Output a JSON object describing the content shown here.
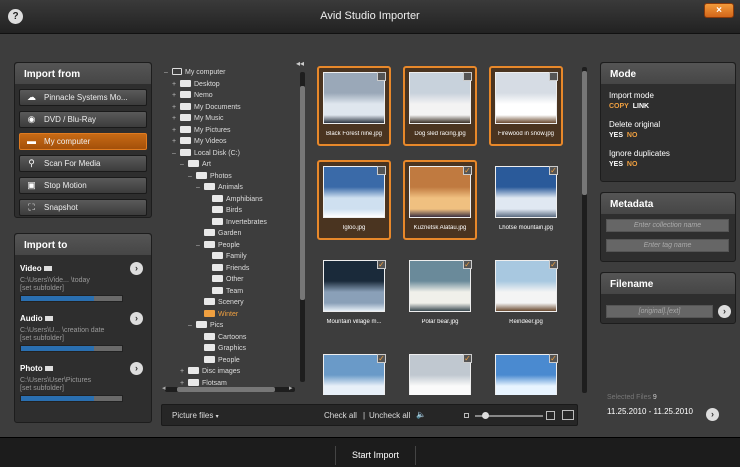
{
  "window": {
    "title": "Avid Studio Importer",
    "help": "?",
    "close": "×"
  },
  "import_from": {
    "header": "Import from",
    "sources": [
      {
        "label": "Pinnacle Systems Mo...",
        "icon": "cloud-icon"
      },
      {
        "label": "DVD / Blu-Ray",
        "icon": "disc-icon"
      },
      {
        "label": "My computer",
        "icon": "folder-icon",
        "selected": true
      },
      {
        "label": "Scan For Media",
        "icon": "magnifier-icon"
      },
      {
        "label": "Stop Motion",
        "icon": "camera-icon"
      },
      {
        "label": "Snapshot",
        "icon": "snapshot-icon"
      }
    ]
  },
  "import_to": {
    "header": "Import to",
    "items": [
      {
        "label": "Video",
        "path": "C:\\Users\\Vide... \\today",
        "subfolder": "[set subfolder]",
        "fill": 0.72
      },
      {
        "label": "Audio",
        "path": "C:\\Users\\U... \\creation date",
        "subfolder": "[set subfolder]",
        "fill": 0.72
      },
      {
        "label": "Photo",
        "path": "C:\\Users\\User\\Pictures",
        "subfolder": "[set subfolder]",
        "fill": 0.72
      }
    ]
  },
  "tree": [
    {
      "label": "My computer",
      "depth": 0,
      "toggle": "–"
    },
    {
      "label": "Desktop",
      "depth": 1,
      "toggle": "+"
    },
    {
      "label": "Nemo",
      "depth": 1,
      "toggle": "+"
    },
    {
      "label": "My Documents",
      "depth": 1,
      "toggle": "+"
    },
    {
      "label": "My Music",
      "depth": 1,
      "toggle": "+"
    },
    {
      "label": "My Pictures",
      "depth": 1,
      "toggle": "+"
    },
    {
      "label": "My Videos",
      "depth": 1,
      "toggle": "+"
    },
    {
      "label": "Local Disk (C:)",
      "depth": 1,
      "toggle": "–"
    },
    {
      "label": "Art",
      "depth": 2,
      "toggle": "–"
    },
    {
      "label": "Photos",
      "depth": 3,
      "toggle": "–"
    },
    {
      "label": "Animals",
      "depth": 4,
      "toggle": "–"
    },
    {
      "label": "Amphibians",
      "depth": 5,
      "toggle": ""
    },
    {
      "label": "Birds",
      "depth": 5,
      "toggle": ""
    },
    {
      "label": "Invertebrates",
      "depth": 5,
      "toggle": ""
    },
    {
      "label": "Garden",
      "depth": 4,
      "toggle": ""
    },
    {
      "label": "People",
      "depth": 4,
      "toggle": "–"
    },
    {
      "label": "Family",
      "depth": 5,
      "toggle": ""
    },
    {
      "label": "Friends",
      "depth": 5,
      "toggle": ""
    },
    {
      "label": "Other",
      "depth": 5,
      "toggle": ""
    },
    {
      "label": "Team",
      "depth": 5,
      "toggle": ""
    },
    {
      "label": "Scenery",
      "depth": 4,
      "toggle": ""
    },
    {
      "label": "Winter",
      "depth": 4,
      "toggle": "",
      "selected": true
    },
    {
      "label": "Pics",
      "depth": 3,
      "toggle": "–"
    },
    {
      "label": "Cartoons",
      "depth": 4,
      "toggle": ""
    },
    {
      "label": "Graphics",
      "depth": 4,
      "toggle": ""
    },
    {
      "label": "People",
      "depth": 4,
      "toggle": ""
    },
    {
      "label": "Disc images",
      "depth": 2,
      "toggle": "+"
    },
    {
      "label": "Flotsam",
      "depth": 2,
      "toggle": "+"
    }
  ],
  "thumbnails": [
    {
      "caption": "Black Forest nine.jpg",
      "selected": true,
      "checked": false,
      "colors": [
        "#9aa8b8",
        "#dfe6ee",
        "#2c3440"
      ]
    },
    {
      "caption": "Dog sled racing.jpg",
      "selected": true,
      "checked": false,
      "colors": [
        "#c8d2dc",
        "#f3f3f3",
        "#3a3026"
      ]
    },
    {
      "caption": "Firewood in snow.jpg",
      "selected": true,
      "checked": false,
      "colors": [
        "#d6dce4",
        "#ffffff",
        "#6a4a30"
      ]
    },
    {
      "caption": "Igloo.jpg",
      "selected": true,
      "checked": false,
      "colors": [
        "#3a6aa8",
        "#cfe0f0",
        "#ffffff"
      ]
    },
    {
      "caption": "Kuznetsk Alatau.jpg",
      "selected": true,
      "checked": true,
      "colors": [
        "#c07a40",
        "#f0c080",
        "#3a3040"
      ]
    },
    {
      "caption": "Lhotse mountain.jpg",
      "selected": false,
      "checked": true,
      "colors": [
        "#2a5a9a",
        "#e0e8f2",
        "#5a6a80"
      ]
    },
    {
      "caption": "Mountain village m...",
      "selected": false,
      "checked": true,
      "colors": [
        "#1a2a3a",
        "#8aa0b8",
        "#e6eef6"
      ]
    },
    {
      "caption": "Polar bear.jpg",
      "selected": false,
      "checked": true,
      "colors": [
        "#6a8a9a",
        "#f0f0ea",
        "#3a4a50"
      ]
    },
    {
      "caption": "Reindeer.jpg",
      "selected": false,
      "checked": true,
      "colors": [
        "#a8c8e0",
        "#f4f4f4",
        "#6a4a30"
      ]
    },
    {
      "caption": "",
      "selected": false,
      "checked": true,
      "colors": [
        "#6a9ac8",
        "#e8f0f8",
        "#2a3a4a"
      ]
    },
    {
      "caption": "",
      "selected": false,
      "checked": true,
      "colors": [
        "#c0c8d0",
        "#fafafa",
        "#5a5a5a"
      ]
    },
    {
      "caption": "",
      "selected": false,
      "checked": true,
      "colors": [
        "#4a8ad0",
        "#e8f4ff",
        "#ffffff"
      ]
    }
  ],
  "bottom_bar": {
    "filter": "Picture files",
    "check_all": "Check all",
    "separator": "|",
    "uncheck_all": "Uncheck all",
    "zoom": 0.15
  },
  "mode": {
    "header": "Mode",
    "import_mode_label": "Import mode",
    "import_mode_options": [
      "COPY",
      "LINK"
    ],
    "import_mode_active": "COPY",
    "delete_original_label": "Delete original",
    "delete_original_options": [
      "YES",
      "NO"
    ],
    "delete_original_active": "NO",
    "ignore_duplicates_label": "Ignore duplicates",
    "ignore_duplicates_options": [
      "YES",
      "NO"
    ],
    "ignore_duplicates_active": "NO"
  },
  "metadata": {
    "header": "Metadata",
    "collection_placeholder": "Enter collection name",
    "tag_placeholder": "Enter tag name"
  },
  "filename": {
    "header": "Filename",
    "value": "[original].[ext]"
  },
  "selected_files": {
    "label": "Selected Files",
    "count": "9",
    "range": "11.25.2010 - 11.25.2010"
  },
  "footer": {
    "start_label": "Start Import"
  },
  "colors": {
    "accent": "#e8882a",
    "active_option": "#f0a040"
  }
}
